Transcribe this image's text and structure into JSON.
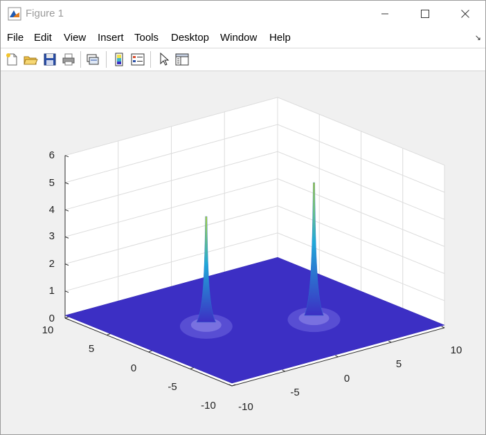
{
  "window": {
    "title": "Figure 1",
    "minimize_icon": "minimize-icon",
    "maximize_icon": "maximize-icon",
    "close_icon": "close-icon"
  },
  "menu": {
    "items": [
      "File",
      "Edit",
      "View",
      "Insert",
      "Tools",
      "Desktop",
      "Window",
      "Help"
    ],
    "dock_icon": "dock-arrow-icon"
  },
  "toolbar": {
    "buttons": [
      {
        "icon": "new-figure-icon"
      },
      {
        "icon": "open-file-icon"
      },
      {
        "icon": "save-icon"
      },
      {
        "icon": "print-icon"
      },
      {
        "icon": "link-plot-icon"
      },
      {
        "icon": "insert-colorbar-icon"
      },
      {
        "icon": "insert-legend-icon"
      },
      {
        "icon": "edit-plot-icon"
      },
      {
        "icon": "property-inspector-icon"
      }
    ]
  },
  "colors": {
    "surface_base": "#3c2fc4",
    "peak_low": "#3c2fc4",
    "peak_mid": "#1fa9d8",
    "peak_high": "#a9d33a",
    "grid": "#dcdcdc",
    "axes_bg": "#ffffff"
  },
  "chart_data": {
    "type": "surface",
    "x_ticks": [
      "10",
      "5",
      "0",
      "-5",
      "-10"
    ],
    "y_ticks": [
      "-10",
      "-5",
      "0",
      "5",
      "10"
    ],
    "z_ticks": [
      "0",
      "1",
      "2",
      "3",
      "4",
      "5",
      "6"
    ],
    "xlim": [
      -10,
      10
    ],
    "ylim": [
      -10,
      10
    ],
    "zlim": [
      0,
      6
    ],
    "grid": true,
    "peaks": [
      {
        "x": -2,
        "y": 4,
        "z": 5
      },
      {
        "x": 2,
        "y": -3,
        "z": 4
      }
    ],
    "base_z": 0.1
  }
}
